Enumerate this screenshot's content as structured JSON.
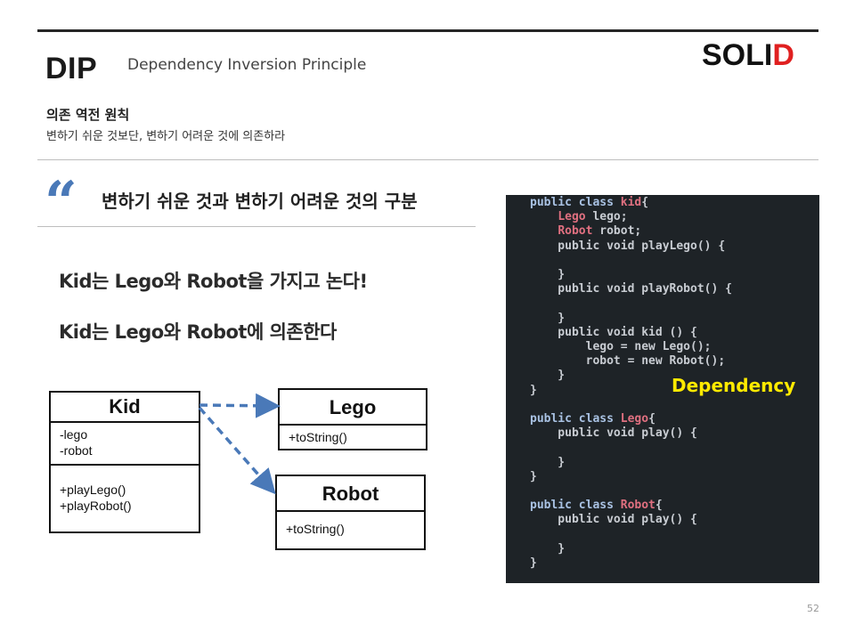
{
  "header": {
    "title": "DIP",
    "subtitle": "Dependency Inversion Principle",
    "brand_main": "SOLI",
    "brand_accent": "D",
    "brand_accent_color": "#e02020",
    "heading": "의존 역전 원칙",
    "description": "변하기 쉬운 것보단, 변하기 어려운 것에 의존하라"
  },
  "quote": {
    "mark": "“",
    "text": "변하기 쉬운 것과 변하기 어려운 것의 구분"
  },
  "statements": [
    "Kid는 Lego와 Robot을 가지고 논다!",
    "Kid는 Lego와 Robot에 의존한다"
  ],
  "uml": {
    "kid": {
      "name": "Kid",
      "attributes": [
        "-lego",
        "-robot"
      ],
      "operations": [
        "+playLego()",
        "+playRobot()"
      ]
    },
    "lego": {
      "name": "Lego",
      "operations": [
        "+toString()"
      ]
    },
    "robot": {
      "name": "Robot",
      "operations": [
        "+toString()"
      ]
    },
    "arrow_color": "#4a79b8"
  },
  "code": {
    "lines": [
      [
        [
          "kw",
          "public class "
        ],
        [
          "nm",
          "kid"
        ],
        [
          "",
          "{"
        ]
      ],
      [
        [
          "",
          "    "
        ],
        [
          "nm",
          "Lego"
        ],
        [
          "",
          " lego;"
        ]
      ],
      [
        [
          "",
          "    "
        ],
        [
          "nm",
          "Robot"
        ],
        [
          "",
          " robot;"
        ]
      ],
      [
        [
          "",
          "    public void playLego() {"
        ]
      ],
      [
        [
          "",
          ""
        ]
      ],
      [
        [
          "",
          "    }"
        ]
      ],
      [
        [
          "",
          "    public void playRobot() {"
        ]
      ],
      [
        [
          "",
          ""
        ]
      ],
      [
        [
          "",
          "    }"
        ]
      ],
      [
        [
          "",
          "    public void kid () {"
        ]
      ],
      [
        [
          "",
          "        lego = new Lego();"
        ]
      ],
      [
        [
          "",
          "        robot = new Robot();"
        ]
      ],
      [
        [
          "",
          "    }"
        ]
      ],
      [
        [
          "",
          "}"
        ]
      ],
      [
        [
          "",
          ""
        ]
      ],
      [
        [
          "kw",
          "public class "
        ],
        [
          "nm",
          "Lego"
        ],
        [
          "",
          "{"
        ]
      ],
      [
        [
          "",
          "    public void play() {"
        ]
      ],
      [
        [
          "",
          ""
        ]
      ],
      [
        [
          "",
          "    }"
        ]
      ],
      [
        [
          "",
          "}"
        ]
      ],
      [
        [
          "",
          ""
        ]
      ],
      [
        [
          "kw",
          "public class "
        ],
        [
          "nm",
          "Robot"
        ],
        [
          "",
          "{"
        ]
      ],
      [
        [
          "",
          "    public void play() {"
        ]
      ],
      [
        [
          "",
          ""
        ]
      ],
      [
        [
          "",
          "    }"
        ]
      ],
      [
        [
          "",
          "}"
        ]
      ]
    ],
    "annotation": "Dependency",
    "annotation_color": "#ffea00"
  },
  "page_number": "52"
}
